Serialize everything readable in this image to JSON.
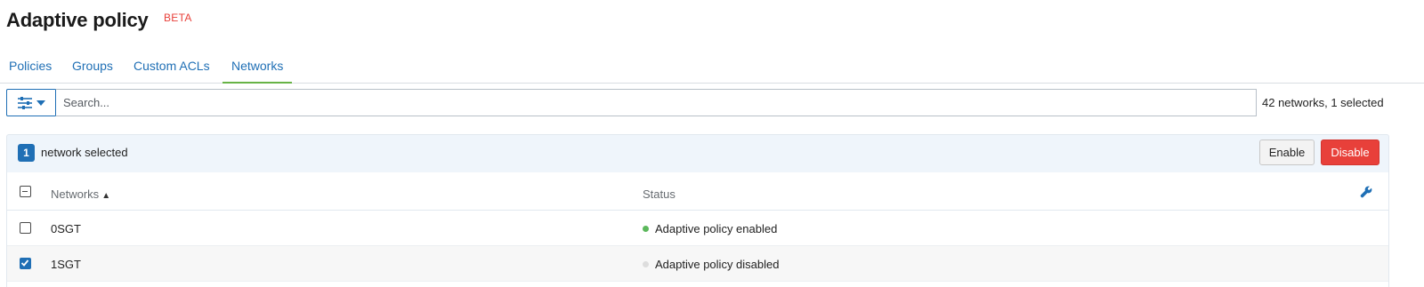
{
  "header": {
    "title": "Adaptive policy",
    "badge": "BETA"
  },
  "tabs": [
    {
      "label": "Policies",
      "active": false
    },
    {
      "label": "Groups",
      "active": false
    },
    {
      "label": "Custom ACLs",
      "active": false
    },
    {
      "label": "Networks",
      "active": true
    }
  ],
  "toolbar": {
    "filter_icon": "sliders-icon",
    "search_placeholder": "Search...",
    "count_text": "42 networks, 1 selected"
  },
  "selection": {
    "count": "1",
    "label": "network selected",
    "enable_label": "Enable",
    "disable_label": "Disable"
  },
  "table": {
    "columns": {
      "name": "Networks",
      "name_sort": "▲",
      "status": "Status"
    },
    "rows": [
      {
        "name": "0SGT",
        "status": "Adaptive policy enabled",
        "enabled": true,
        "checked": false
      },
      {
        "name": "1SGT",
        "status": "Adaptive policy disabled",
        "enabled": false,
        "checked": true
      }
    ]
  },
  "colors": {
    "accent": "#1f6fb5",
    "tab_underline": "#67b346",
    "danger": "#e8403a",
    "status_enabled": "#5cb85c",
    "status_disabled": "#dddddd"
  }
}
